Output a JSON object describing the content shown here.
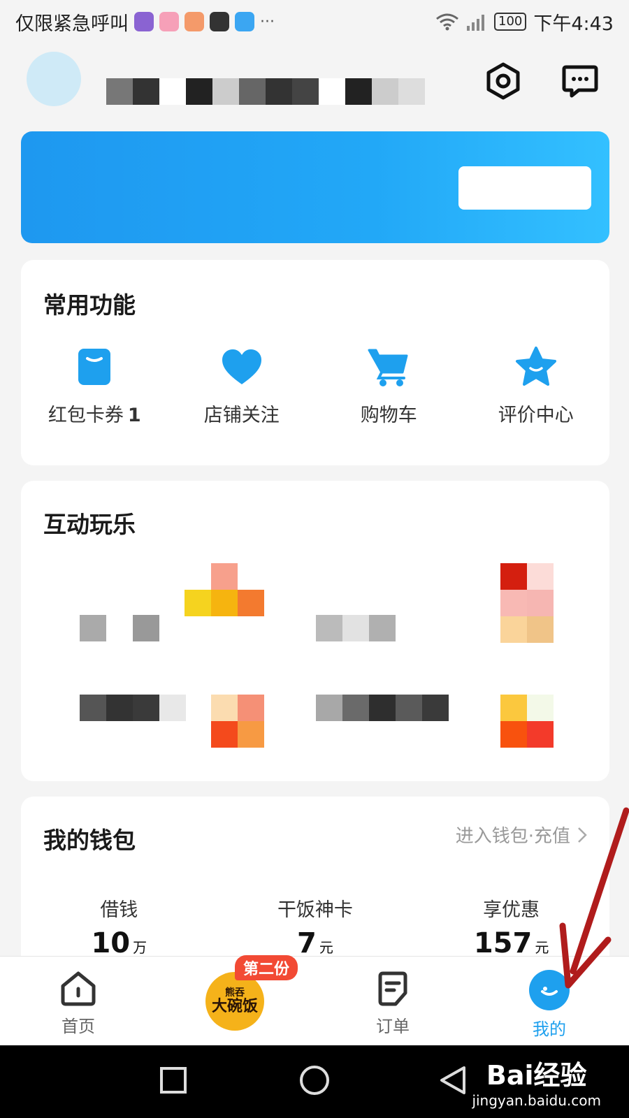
{
  "status_bar": {
    "carrier_text": "仅限紧急呼叫",
    "more": "···",
    "battery": "100",
    "time": "下午4:43"
  },
  "header": {
    "settings_icon": "settings-icon",
    "message_icon": "message-icon"
  },
  "common_functions": {
    "title": "常用功能",
    "items": [
      {
        "label": "红包卡券",
        "count": "1",
        "icon": "coupon-icon"
      },
      {
        "label": "店铺关注",
        "icon": "heart-icon"
      },
      {
        "label": "购物车",
        "icon": "cart-icon"
      },
      {
        "label": "评价中心",
        "icon": "star-icon"
      }
    ]
  },
  "interactive": {
    "title": "互动玩乐"
  },
  "wallet": {
    "title": "我的钱包",
    "link": "进入钱包·充值",
    "items": [
      {
        "label": "借钱",
        "value": "10",
        "unit": "万"
      },
      {
        "label": "干饭神卡",
        "value": "7",
        "unit": "元"
      },
      {
        "label": "享优惠",
        "value": "157",
        "unit": "元"
      }
    ]
  },
  "tabbar": {
    "tabs": [
      {
        "label": "首页",
        "icon": "home-icon"
      },
      {
        "label": "订单",
        "icon": "order-icon"
      },
      {
        "label": "我的",
        "icon": "profile-icon",
        "active": true
      }
    ],
    "promo_badge": "第二份",
    "promo_brand": "大碗饭",
    "promo_top": "熊吞",
    "accent_color": "#1ea0ee"
  },
  "watermark": {
    "line1": "Bai经验",
    "line2": "jingyan.baidu.com"
  }
}
